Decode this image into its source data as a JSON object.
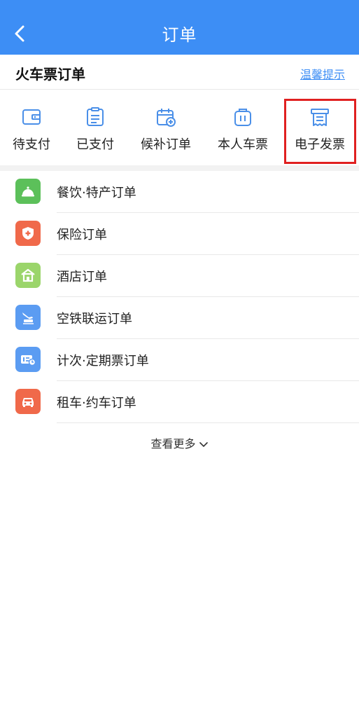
{
  "header": {
    "title": "订单"
  },
  "section": {
    "title": "火车票订单",
    "tips_link": "温馨提示"
  },
  "shortcuts": [
    {
      "label": "待支付",
      "icon": "wallet-icon"
    },
    {
      "label": "已支付",
      "icon": "document-list-icon"
    },
    {
      "label": "候补订单",
      "icon": "calendar-add-icon"
    },
    {
      "label": "本人车票",
      "icon": "ticket-bag-icon"
    },
    {
      "label": "电子发票",
      "icon": "receipt-icon"
    }
  ],
  "orders": [
    {
      "label": "餐饮·特产订单",
      "icon": "food-bell-icon",
      "color": "#5cc05a"
    },
    {
      "label": "保险订单",
      "icon": "shield-icon",
      "color": "#f0694a"
    },
    {
      "label": "酒店订单",
      "icon": "hotel-icon",
      "color": "#9bd56b"
    },
    {
      "label": "空铁联运订单",
      "icon": "plane-train-icon",
      "color": "#5b9cf2"
    },
    {
      "label": "计次·定期票订单",
      "icon": "pass-ticket-icon",
      "color": "#5b9cf2"
    },
    {
      "label": "租车·约车订单",
      "icon": "car-icon",
      "color": "#f0694a"
    }
  ],
  "more": {
    "label": "查看更多"
  },
  "colors": {
    "primary": "#3d8ef5",
    "highlight": "#e02020"
  }
}
